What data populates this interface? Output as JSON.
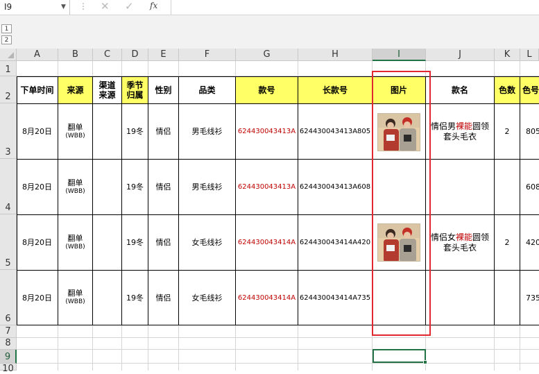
{
  "formula_bar": {
    "name_box": "I9",
    "dots": "⋮",
    "cancel": "✕",
    "confirm": "✓",
    "fx": "fx",
    "value": ""
  },
  "outline_levels": [
    "1",
    "2"
  ],
  "columns": [
    "A",
    "B",
    "C",
    "D",
    "E",
    "F",
    "G",
    "H",
    "I",
    "J",
    "K",
    "L"
  ],
  "rows": [
    "1",
    "2",
    "3",
    "4",
    "5",
    "6",
    "7",
    "8",
    "9",
    "10"
  ],
  "selected_cell": {
    "column": "I",
    "row": "9"
  },
  "headers": {
    "A": "下单时间",
    "B": "来源",
    "C1": "渠道",
    "C2": "来源",
    "D1": "季节",
    "D2": "归属",
    "E": "性别",
    "F": "品类",
    "G": "款号",
    "H": "长款号",
    "I": "图片",
    "J": "款名",
    "K": "色数",
    "L": "色号"
  },
  "data_rows": [
    {
      "date": "8月20日",
      "src1": "翻单",
      "src2": "(WBB)",
      "season": "19冬",
      "gender": "情侣",
      "category": "男毛线衫",
      "style": "624430043413A",
      "long_style": "624430043413A805",
      "has_image": true,
      "name_a": "情侣男",
      "name_red": "裸能",
      "name_b": "圆领",
      "name_c": "套头毛衣",
      "color_count": "2",
      "color_code": "805"
    },
    {
      "date": "8月20日",
      "src1": "翻单",
      "src2": "(WBB)",
      "season": "19冬",
      "gender": "情侣",
      "category": "男毛线衫",
      "style": "624430043413A",
      "long_style": "624430043413A608",
      "has_image": false,
      "name_a": "",
      "name_red": "",
      "name_b": "",
      "name_c": "",
      "color_count": "",
      "color_code": "608"
    },
    {
      "date": "8月20日",
      "src1": "翻单",
      "src2": "(WBB)",
      "season": "19冬",
      "gender": "情侣",
      "category": "女毛线衫",
      "style": "624430043414A",
      "long_style": "624430043414A420",
      "has_image": true,
      "name_a": "情侣女",
      "name_red": "裸能",
      "name_b": "圆领",
      "name_c": "套头毛衣",
      "color_count": "2",
      "color_code": "420"
    },
    {
      "date": "8月20日",
      "src1": "翻单",
      "src2": "(WBB)",
      "season": "19冬",
      "gender": "情侣",
      "category": "女毛线衫",
      "style": "624430043414A",
      "long_style": "624430043414A735",
      "has_image": false,
      "name_a": "",
      "name_red": "",
      "name_b": "",
      "name_c": "",
      "color_count": "",
      "color_code": "735"
    }
  ],
  "colors": {
    "header_yellow": "#ffff66",
    "style_red": "#c00000",
    "highlight_box": "#e0282e",
    "excel_green": "#217346"
  }
}
